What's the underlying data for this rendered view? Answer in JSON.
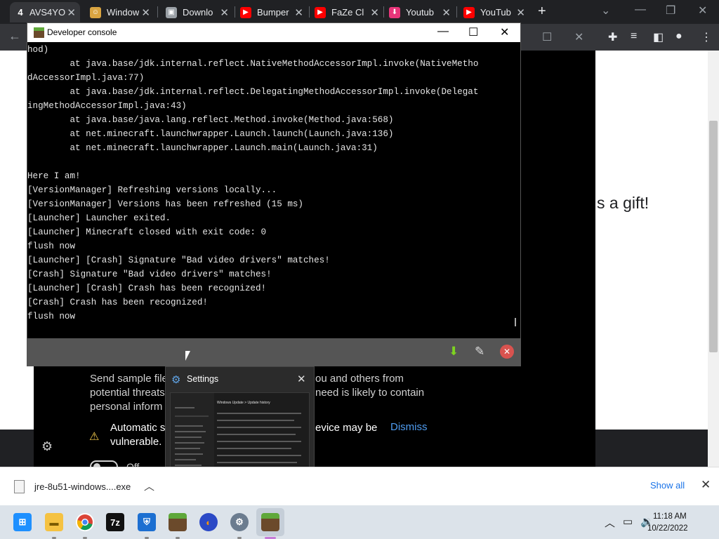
{
  "browser": {
    "tabs": [
      {
        "label": "AVS4YO",
        "favicon": "4"
      },
      {
        "label": "Window",
        "favicon": "avatar"
      },
      {
        "label": "Downlo",
        "favicon": "box"
      },
      {
        "label": "Bumper",
        "favicon": "youtube"
      },
      {
        "label": "FaZe Cl",
        "favicon": "youtube"
      },
      {
        "label": "Youtub",
        "favicon": "download"
      },
      {
        "label": "YouTub",
        "favicon": "youtube"
      }
    ],
    "colors": {
      "youtube": "#ff0000",
      "dark": "#202124"
    }
  },
  "page": {
    "gift_text": "s a gift!",
    "security_para_left": [
      "Send sample file",
      "potential threats",
      "personal inform"
    ],
    "security_para_right": [
      "ou and others from",
      "need is likely to contain"
    ],
    "warning_left": [
      "Automatic s",
      "vulnerable."
    ],
    "warning_right": "evice may be",
    "dismiss": "Dismiss",
    "toggle_label": "Off"
  },
  "dev_console": {
    "title": "Developer console",
    "lines": [
      "hod)",
      "        at java.base/jdk.internal.reflect.NativeMethodAccessorImpl.invoke(NativeMetho",
      "dAccessorImpl.java:77)",
      "        at java.base/jdk.internal.reflect.DelegatingMethodAccessorImpl.invoke(Delegat",
      "ingMethodAccessorImpl.java:43)",
      "        at java.base/java.lang.reflect.Method.invoke(Method.java:568)",
      "        at net.minecraft.launchwrapper.Launch.launch(Launch.java:136)",
      "        at net.minecraft.launchwrapper.Launch.main(Launch.java:31)",
      "",
      "Here I am!",
      "[VersionManager] Refreshing versions locally...",
      "[VersionManager] Versions has been refreshed (15 ms)",
      "[Launcher] Launcher exited.",
      "[Launcher] Minecraft closed with exit code: 0",
      "flush now",
      "[Launcher] [Crash] Signature \"Bad video drivers\" matches!",
      "[Crash] Signature \"Bad video drivers\" matches!",
      "[Launcher] [Crash] Crash has been recognized!",
      "[Crash] Crash has been recognized!",
      "flush now"
    ]
  },
  "settings_preview": {
    "title": "Settings",
    "thumb_title": "Windows Update  >  Update history"
  },
  "downloads_bar": {
    "filename": "jre-8u51-windows....exe",
    "show_all": "Show all"
  },
  "taskbar": {
    "apps": [
      "start",
      "file-explorer",
      "chrome",
      "7-zip",
      "windows-security",
      "minecraft",
      "firefox-like",
      "settings",
      "minecraft-launcher"
    ],
    "time": "11:18 AM",
    "date": "10/22/2022"
  }
}
